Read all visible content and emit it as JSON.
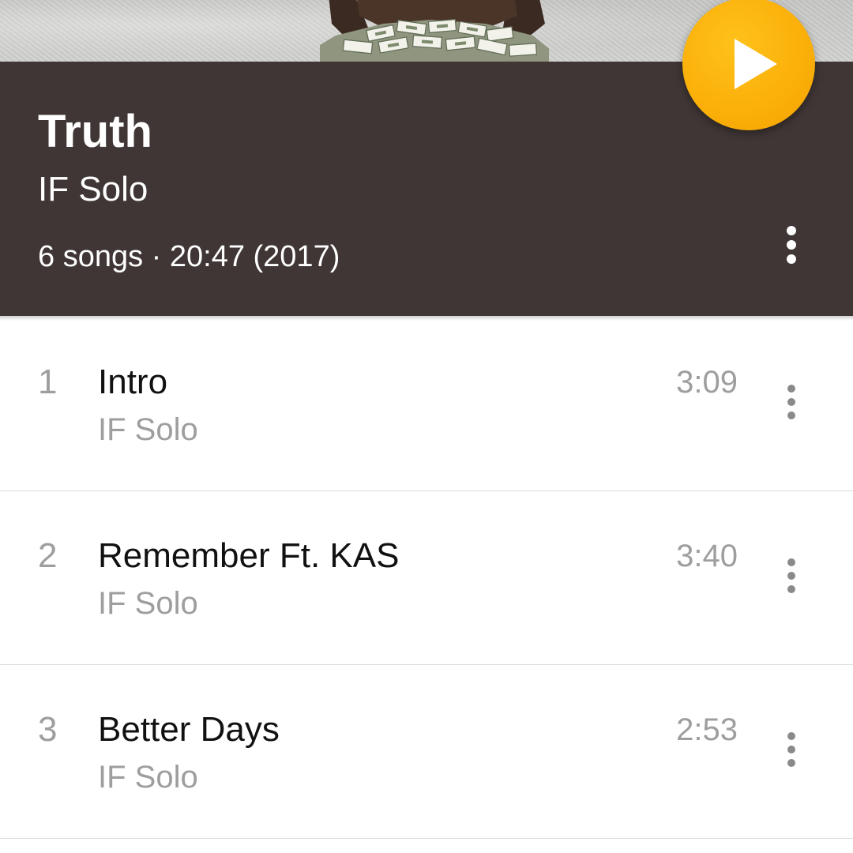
{
  "album": {
    "title": "Truth",
    "artist": "IF Solo",
    "meta": "6 songs · 20:47 (2017)"
  },
  "colors": {
    "header_bg": "#3f3635",
    "fab_accent": "#fbb00a",
    "secondary_text": "#9e9e9e"
  },
  "icons": {
    "fab": "play-icon",
    "header_menu": "more-vert-icon",
    "track_menu": "more-vert-icon"
  },
  "tracks": [
    {
      "number": "1",
      "title": "Intro",
      "artist": "IF Solo",
      "duration": "3:09"
    },
    {
      "number": "2",
      "title": "Remember Ft. KAS",
      "artist": "IF Solo",
      "duration": "3:40"
    },
    {
      "number": "3",
      "title": "Better Days",
      "artist": "IF Solo",
      "duration": "2:53"
    }
  ]
}
